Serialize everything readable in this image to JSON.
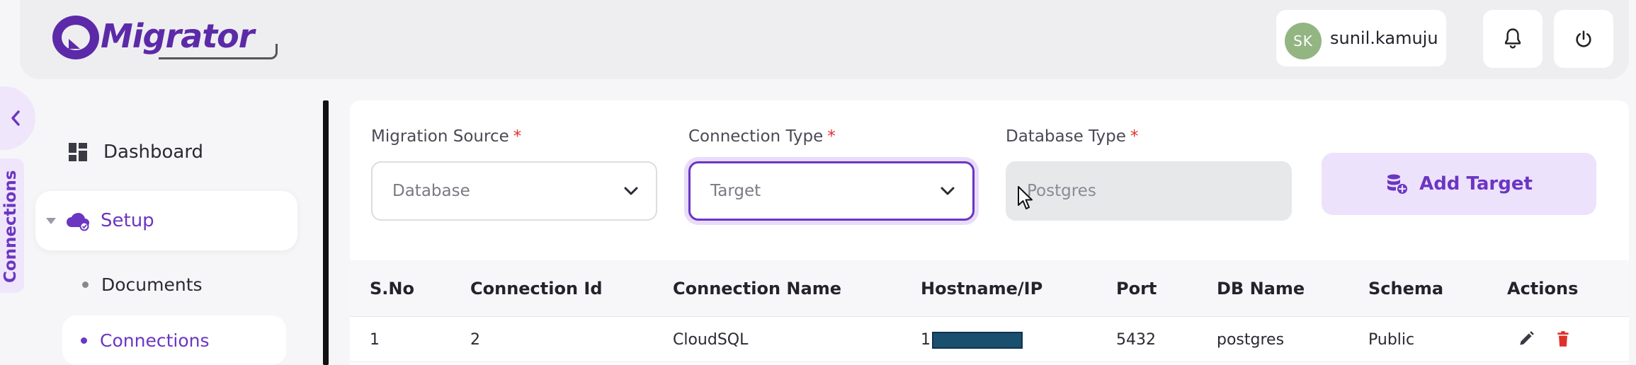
{
  "header": {
    "logo_text": "Migrator",
    "user": {
      "initials": "SK",
      "name": "sunil.kamuju",
      "avatar_color": "#93b582"
    },
    "icons": {
      "notifications": "bell-icon",
      "logout": "power-icon"
    }
  },
  "sidebar": {
    "collapse_icon": "chevron-left-icon",
    "vertical_tab_label": "Connections",
    "items": [
      {
        "label": "Dashboard",
        "icon": "dashboard-icon"
      },
      {
        "label": "Setup",
        "icon": "cloud-settings-icon",
        "expanded": true
      }
    ],
    "sub_items": [
      {
        "label": "Documents"
      },
      {
        "label": "Connections",
        "active": true
      }
    ]
  },
  "form": {
    "migration_source": {
      "label": "Migration Source",
      "value": "Database"
    },
    "connection_type": {
      "label": "Connection Type",
      "value": "Target"
    },
    "database_type": {
      "label": "Database Type",
      "value": "Postgres"
    },
    "required_mark": "*",
    "add_button_label": "Add Target"
  },
  "table": {
    "headers": [
      "S.No",
      "Connection Id",
      "Connection Name",
      "Hostname/IP",
      "Port",
      "DB Name",
      "Schema",
      "Actions"
    ],
    "rows": [
      {
        "sno": "1",
        "connection_id": "2",
        "connection_name": "CloudSQL",
        "hostname_prefix": "1",
        "port": "5432",
        "db_name": "postgres",
        "schema": "Public"
      }
    ]
  },
  "colors": {
    "accent": "#6b36c2",
    "accent_light": "#ede2fc",
    "required": "#e0302b",
    "delete": "#e0302b"
  }
}
